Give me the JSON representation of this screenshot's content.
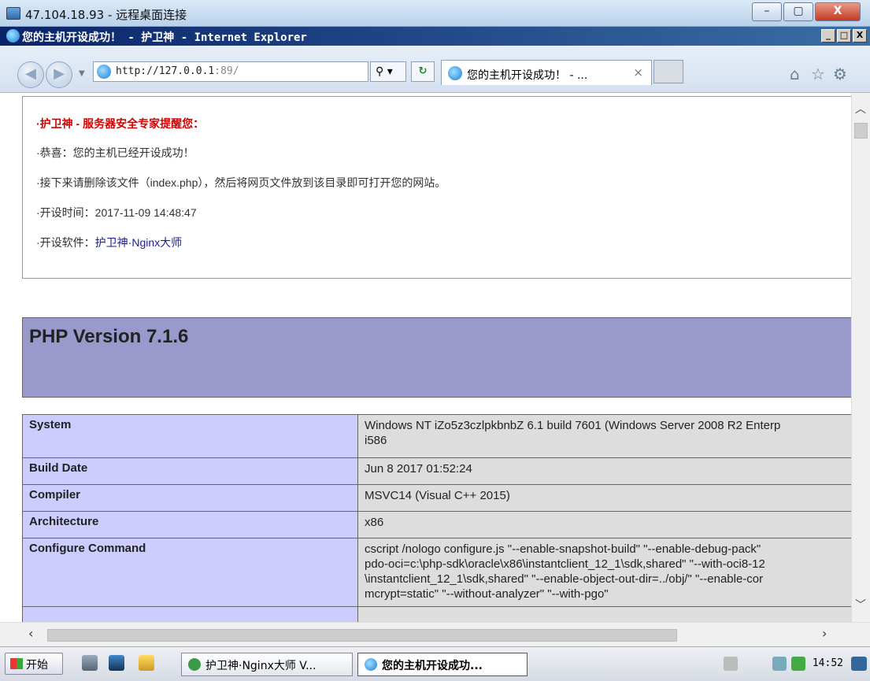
{
  "rdp": {
    "title": "47.104.18.93 - 远程桌面连接",
    "buttons": [
      "–",
      "▢",
      "X"
    ]
  },
  "ie": {
    "title": "您的主机开设成功！ - 护卫神 - Internet Explorer",
    "window_buttons": [
      "_",
      "□",
      "X"
    ],
    "address_host": "http://127.0.0.1",
    "address_port": ":89/",
    "search_icon": "search-icon",
    "tab_label": "您的主机开设成功！ - ...",
    "tab_close": "×"
  },
  "notice": {
    "heading": "·护卫神 - 服务器安全专家提醒您：",
    "congrats": "·恭喜：您的主机已经开设成功！",
    "instruction": "·接下来请删除该文件（index.php），然后将网页文件放到该目录即可打开您的网站。",
    "open_time_label": "·开设时间：",
    "open_time": "2017-11-09 14:48:47",
    "software_label": "·开设软件：",
    "software_link": "护卫神·Nginx大师"
  },
  "php": {
    "title": "PHP Version 7.1.6",
    "rows": [
      {
        "key": "System",
        "value": "Windows NT iZo5z3czlpkbnbZ 6.1 build 7601 (Windows Server 2008 R2 Enterp",
        "value2": "i586"
      },
      {
        "key": "Build Date",
        "value": "Jun 8 2017 01:52:24"
      },
      {
        "key": "Compiler",
        "value": "MSVC14 (Visual C++ 2015)"
      },
      {
        "key": "Architecture",
        "value": "x86"
      },
      {
        "key": "Configure Command",
        "lines": [
          "cscript /nologo configure.js \"--enable-snapshot-build\" \"--enable-debug-pack\"",
          "pdo-oci=c:\\php-sdk\\oracle\\x86\\instantclient_12_1\\sdk,shared\" \"--with-oci8-12",
          "\\instantclient_12_1\\sdk,shared\" \"--enable-object-out-dir=../obj/\" \"--enable-cor",
          "mcrypt=static\" \"--without-analyzer\" \"--with-pgo\""
        ]
      }
    ]
  },
  "taskbar": {
    "start": "开始",
    "task1": "护卫神·Nginx大师 V...",
    "task2": "您的主机开设成功...",
    "clock": "14:52"
  },
  "colors": {
    "php_banner": "#9999cc",
    "key_cell": "#ccccff",
    "value_cell": "#dddddd",
    "notice_red": "#d40000"
  }
}
